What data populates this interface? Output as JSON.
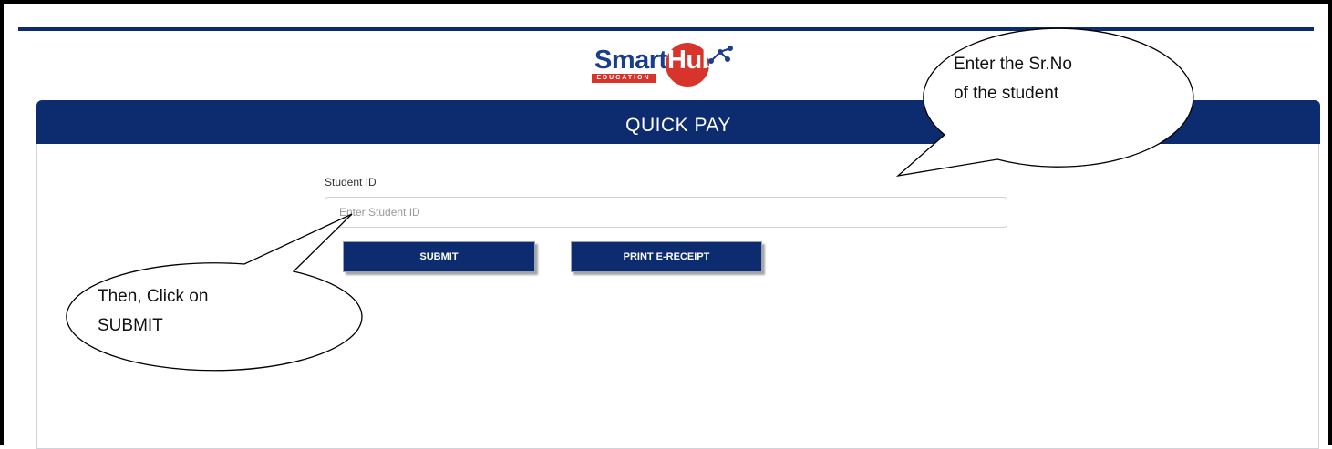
{
  "logo": {
    "smart": "Smart",
    "hub": "Hub",
    "tagline": "EDUCATION"
  },
  "panel": {
    "title": "QUICK PAY"
  },
  "form": {
    "student_id_label": "Student ID",
    "student_id_placeholder": "Enter Student ID",
    "submit_label": "SUBMIT",
    "print_label": "PRINT E-RECEIPT"
  },
  "annotations": {
    "callout_1_line1": "Enter the Sr.No",
    "callout_1_line2": "of the student",
    "callout_2_line1": "Then, Click on",
    "callout_2_line2": "SUBMIT"
  },
  "colors": {
    "brand_navy": "#0d2c6f",
    "brand_red": "#d9342b"
  }
}
